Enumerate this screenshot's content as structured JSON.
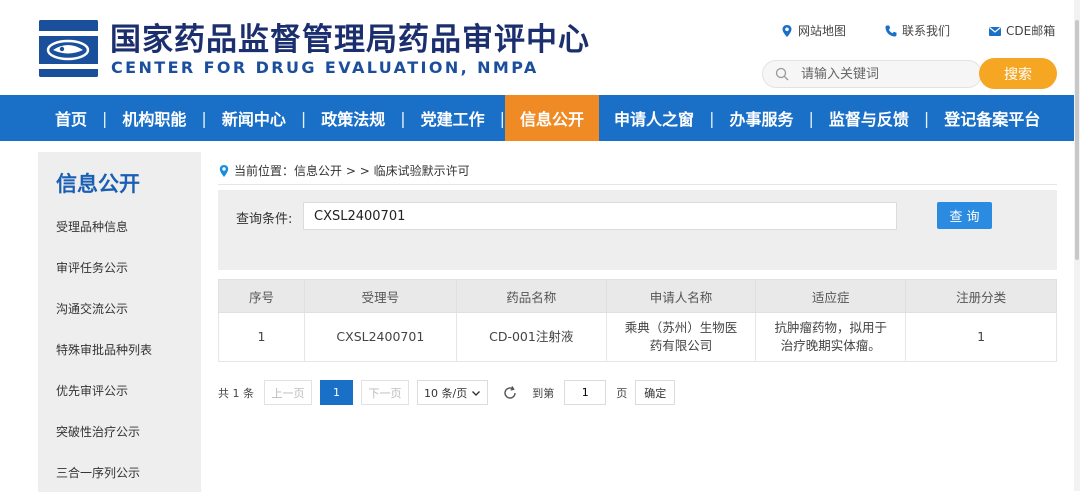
{
  "header": {
    "title": "国家药品监督管理局药品审评中心",
    "subtitle": "CENTER FOR DRUG EVALUATION, NMPA",
    "links": [
      {
        "label": "网站地图",
        "icon": "location-pin-icon"
      },
      {
        "label": "联系我们",
        "icon": "phone-icon"
      },
      {
        "label": "CDE邮箱",
        "icon": "mail-icon"
      }
    ],
    "search_placeholder": "请输入关键词",
    "search_button": "搜索"
  },
  "nav": {
    "items": [
      "首页",
      "机构职能",
      "新闻中心",
      "政策法规",
      "党建工作",
      "信息公开",
      "申请人之窗",
      "办事服务",
      "监督与反馈",
      "登记备案平台"
    ],
    "active": "信息公开"
  },
  "sidebar": {
    "title": "信息公开",
    "items": [
      "受理品种信息",
      "审评任务公示",
      "沟通交流公示",
      "特殊审批品种列表",
      "优先审评公示",
      "突破性治疗公示",
      "三合一序列公示"
    ]
  },
  "breadcrumb": {
    "prefix": "当前位置：",
    "path": "信息公开 > > 临床试验默示许可"
  },
  "query": {
    "label": "查询条件:",
    "value": "CXSL2400701",
    "button": "查 询"
  },
  "table": {
    "headers": [
      "序号",
      "受理号",
      "药品名称",
      "申请人名称",
      "适应症",
      "注册分类"
    ],
    "rows": [
      [
        "1",
        "CXSL2400701",
        "CD-001注射液",
        "乘典（苏州）生物医药有限公司",
        "抗肿瘤药物，拟用于治疗晚期实体瘤。",
        "1"
      ]
    ]
  },
  "pager": {
    "total": "共 1 条",
    "prev": "上一页",
    "current": "1",
    "next": "下一页",
    "page_size": "10 条/页",
    "goto_label": "到第",
    "goto_value": "1",
    "page_unit": "页",
    "confirm": "确定"
  },
  "colors": {
    "nav_bg": "#1a6fc7",
    "active_nav": "#f08a24",
    "search_button": "#f5a623",
    "title_color": "#1b2f6e"
  }
}
